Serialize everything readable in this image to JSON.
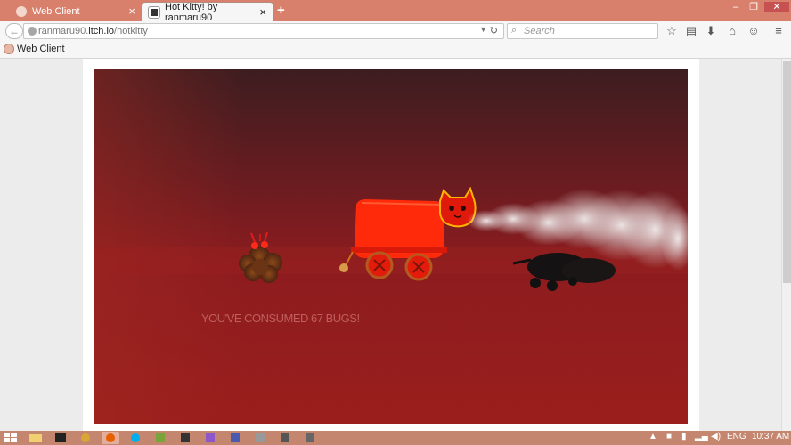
{
  "browser": {
    "tabs": [
      {
        "title": "Web Client",
        "active": false
      },
      {
        "title": "Hot Kitty! by ranmaru90",
        "active": true
      }
    ],
    "url_prefix": "ranmaru90.",
    "url_domain": "itch.io",
    "url_path": "/hotkitty",
    "search_placeholder": "Search",
    "bookmark": "Web Client"
  },
  "game": {
    "message": "YOU'VE CONSUMED 67 BUGS!",
    "colors": {
      "background": "#8e1b1f",
      "cart": "#ff2a0a",
      "cat_outline": "#ffb400"
    }
  },
  "taskbar": {
    "language": "ENG",
    "time": "10:37 AM"
  }
}
